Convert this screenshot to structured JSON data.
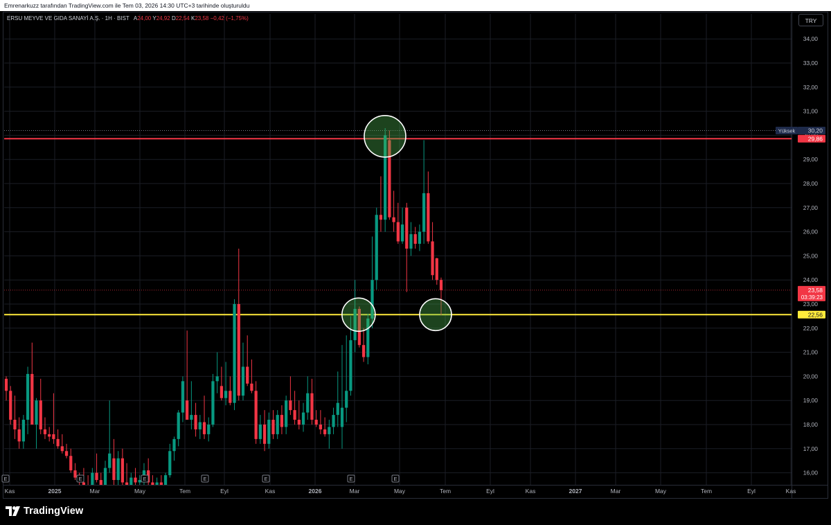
{
  "header": {
    "caption": "Emrenarkuzz tarafından TradingView.com ile Tem 03, 2026 14:30 UTC+3 tarihinde oluşturuldu"
  },
  "legend": {
    "symbol": "ERSU MEYVE VE GIDA SANAYİ A.Ş. · 1H · BIST",
    "open_label": "A",
    "open": "24,00",
    "high_label": "Y",
    "high": "24,92",
    "low_label": "D",
    "low": "22,54",
    "close_label": "K",
    "close": "23,58",
    "change": "−0,42 (−1,75%)"
  },
  "currency_button": "TRY",
  "brand": "TradingView",
  "chart_data": {
    "type": "candlestick",
    "title": "",
    "y_axis": {
      "min": 15.7,
      "max": 34.6,
      "ticks": [
        16,
        17,
        18,
        19,
        20,
        21,
        22,
        23,
        24,
        25,
        26,
        27,
        28,
        29,
        30,
        31,
        32,
        33,
        34
      ],
      "tick_labels": [
        "16,00",
        "17,00",
        "18,00",
        "19,00",
        "20,00",
        "21,00",
        "22,00",
        "23,00",
        "24,00",
        "25,00",
        "26,00",
        "27,00",
        "28,00",
        "29,00",
        "30,00",
        "31,00",
        "32,00",
        "33,00",
        "34,00"
      ],
      "position": "right"
    },
    "x_axis": {
      "labels": [
        "Kas",
        "2025",
        "Mar",
        "May",
        "Tem",
        "Eyl",
        "Kas",
        "2026",
        "Mar",
        "May",
        "Tem",
        "Eyl",
        "Kas",
        "2027",
        "Mar",
        "May",
        "Tem",
        "Eyl",
        "Kas"
      ],
      "bold_labels": [
        "2025",
        "2026",
        "2027"
      ]
    },
    "earnings_markers": {
      "label": "E",
      "count": 7
    },
    "horizontal_lines": [
      {
        "value": 29.86,
        "label": "29,86",
        "color": "#f23645"
      },
      {
        "value": 22.56,
        "label": "22,56",
        "color": "#ffeb3b"
      }
    ],
    "high_marker": {
      "value": 30.2,
      "label": "30,20",
      "title": "Yüksek"
    },
    "last_price": {
      "value": 23.58,
      "label": "23,58",
      "countdown": "03:39:23"
    },
    "highlight_circles": 3,
    "colors": {
      "up": "#089981",
      "down": "#f23645",
      "grid": "#1b1e26",
      "axis_text": "#b2b5be"
    },
    "candles": [
      {
        "o": 19.9,
        "h": 20.0,
        "l": 19.0,
        "c": 19.4
      },
      {
        "o": 19.4,
        "h": 19.6,
        "l": 18.0,
        "c": 18.2
      },
      {
        "o": 18.2,
        "h": 19.2,
        "l": 17.4,
        "c": 17.8
      },
      {
        "o": 17.8,
        "h": 18.3,
        "l": 17.0,
        "c": 17.3
      },
      {
        "o": 17.3,
        "h": 18.4,
        "l": 17.0,
        "c": 18.2
      },
      {
        "o": 18.2,
        "h": 20.4,
        "l": 17.6,
        "c": 20.1
      },
      {
        "o": 20.1,
        "h": 21.4,
        "l": 18.0,
        "c": 18.0
      },
      {
        "o": 18.0,
        "h": 19.1,
        "l": 17.0,
        "c": 19.0
      },
      {
        "o": 19.0,
        "h": 19.9,
        "l": 17.6,
        "c": 17.8
      },
      {
        "o": 17.8,
        "h": 18.3,
        "l": 17.4,
        "c": 17.6
      },
      {
        "o": 17.6,
        "h": 17.9,
        "l": 17.3,
        "c": 17.5
      },
      {
        "o": 17.6,
        "h": 19.3,
        "l": 17.2,
        "c": 17.4
      },
      {
        "o": 17.4,
        "h": 17.8,
        "l": 17.0,
        "c": 17.1
      },
      {
        "o": 17.1,
        "h": 17.6,
        "l": 16.8,
        "c": 16.9
      },
      {
        "o": 16.9,
        "h": 17.2,
        "l": 16.6,
        "c": 16.7
      },
      {
        "o": 16.7,
        "h": 17.0,
        "l": 16.0,
        "c": 16.1
      },
      {
        "o": 16.1,
        "h": 16.4,
        "l": 15.7,
        "c": 15.8
      },
      {
        "o": 15.8,
        "h": 16.0,
        "l": 15.5,
        "c": 15.6
      },
      {
        "o": 15.6,
        "h": 16.2,
        "l": 15.3,
        "c": 15.5
      },
      {
        "o": 15.5,
        "h": 15.9,
        "l": 15.2,
        "c": 15.4
      },
      {
        "o": 15.4,
        "h": 16.2,
        "l": 15.3,
        "c": 16.0
      },
      {
        "o": 16.0,
        "h": 16.8,
        "l": 15.6,
        "c": 15.7
      },
      {
        "o": 15.7,
        "h": 16.0,
        "l": 15.3,
        "c": 15.5
      },
      {
        "o": 15.5,
        "h": 16.5,
        "l": 15.4,
        "c": 16.2
      },
      {
        "o": 16.2,
        "h": 19.0,
        "l": 16.0,
        "c": 16.8
      },
      {
        "o": 16.6,
        "h": 17.4,
        "l": 15.4,
        "c": 15.7
      },
      {
        "o": 15.7,
        "h": 16.9,
        "l": 15.4,
        "c": 16.6
      },
      {
        "o": 16.6,
        "h": 17.0,
        "l": 15.4,
        "c": 15.6
      },
      {
        "o": 15.6,
        "h": 16.4,
        "l": 15.2,
        "c": 15.5
      },
      {
        "o": 15.5,
        "h": 16.0,
        "l": 15.2,
        "c": 15.8
      },
      {
        "o": 15.8,
        "h": 16.2,
        "l": 15.4,
        "c": 15.6
      },
      {
        "o": 15.6,
        "h": 15.9,
        "l": 15.3,
        "c": 15.7
      },
      {
        "o": 15.7,
        "h": 16.4,
        "l": 15.4,
        "c": 16.1
      },
      {
        "o": 16.1,
        "h": 16.6,
        "l": 15.5,
        "c": 15.6
      },
      {
        "o": 15.6,
        "h": 15.9,
        "l": 15.2,
        "c": 15.5
      },
      {
        "o": 15.5,
        "h": 15.8,
        "l": 15.3,
        "c": 15.6
      },
      {
        "o": 15.6,
        "h": 15.9,
        "l": 15.3,
        "c": 15.4
      },
      {
        "o": 15.4,
        "h": 16.0,
        "l": 15.3,
        "c": 15.9
      },
      {
        "o": 15.9,
        "h": 17.2,
        "l": 15.8,
        "c": 16.9
      },
      {
        "o": 16.9,
        "h": 17.5,
        "l": 16.5,
        "c": 17.4
      },
      {
        "o": 17.4,
        "h": 18.6,
        "l": 17.1,
        "c": 18.5
      },
      {
        "o": 18.5,
        "h": 20.0,
        "l": 18.1,
        "c": 19.8
      },
      {
        "o": 19.0,
        "h": 21.9,
        "l": 18.2,
        "c": 18.2
      },
      {
        "o": 18.2,
        "h": 19.8,
        "l": 17.8,
        "c": 18.4
      },
      {
        "o": 18.4,
        "h": 18.9,
        "l": 17.5,
        "c": 17.8
      },
      {
        "o": 17.8,
        "h": 18.4,
        "l": 17.4,
        "c": 18.1
      },
      {
        "o": 18.1,
        "h": 19.2,
        "l": 17.4,
        "c": 17.6
      },
      {
        "o": 17.6,
        "h": 18.3,
        "l": 17.3,
        "c": 18.0
      },
      {
        "o": 18.0,
        "h": 20.1,
        "l": 17.9,
        "c": 19.8
      },
      {
        "o": 19.8,
        "h": 21.0,
        "l": 19.3,
        "c": 20.0
      },
      {
        "o": 19.6,
        "h": 20.4,
        "l": 19.0,
        "c": 19.1
      },
      {
        "o": 19.1,
        "h": 20.6,
        "l": 18.8,
        "c": 19.4
      },
      {
        "o": 19.4,
        "h": 20.0,
        "l": 18.8,
        "c": 18.9
      },
      {
        "o": 18.9,
        "h": 23.2,
        "l": 18.6,
        "c": 23.0
      },
      {
        "o": 23.0,
        "h": 25.3,
        "l": 19.0,
        "c": 19.2
      },
      {
        "o": 19.2,
        "h": 21.4,
        "l": 19.0,
        "c": 20.4
      },
      {
        "o": 20.4,
        "h": 21.7,
        "l": 19.6,
        "c": 19.7
      },
      {
        "o": 19.7,
        "h": 20.7,
        "l": 19.3,
        "c": 19.4
      },
      {
        "o": 19.4,
        "h": 19.8,
        "l": 17.2,
        "c": 17.4
      },
      {
        "o": 17.4,
        "h": 18.4,
        "l": 17.2,
        "c": 18.0
      },
      {
        "o": 18.0,
        "h": 18.6,
        "l": 16.9,
        "c": 17.2
      },
      {
        "o": 17.2,
        "h": 18.5,
        "l": 17.0,
        "c": 18.2
      },
      {
        "o": 18.2,
        "h": 18.6,
        "l": 17.4,
        "c": 17.6
      },
      {
        "o": 17.6,
        "h": 18.6,
        "l": 17.4,
        "c": 18.4
      },
      {
        "o": 18.4,
        "h": 18.8,
        "l": 17.6,
        "c": 17.9
      },
      {
        "o": 17.9,
        "h": 19.2,
        "l": 17.6,
        "c": 19.0
      },
      {
        "o": 19.0,
        "h": 20.0,
        "l": 18.4,
        "c": 18.6
      },
      {
        "o": 18.6,
        "h": 19.4,
        "l": 18.0,
        "c": 18.2
      },
      {
        "o": 18.2,
        "h": 19.0,
        "l": 17.8,
        "c": 18.0
      },
      {
        "o": 18.0,
        "h": 18.9,
        "l": 17.7,
        "c": 18.5
      },
      {
        "o": 18.5,
        "h": 20.0,
        "l": 18.2,
        "c": 19.3
      },
      {
        "o": 19.3,
        "h": 19.9,
        "l": 18.0,
        "c": 18.2
      },
      {
        "o": 18.2,
        "h": 18.6,
        "l": 17.9,
        "c": 18.0
      },
      {
        "o": 18.0,
        "h": 18.6,
        "l": 17.6,
        "c": 17.8
      },
      {
        "o": 17.8,
        "h": 18.3,
        "l": 17.5,
        "c": 17.6
      },
      {
        "o": 17.6,
        "h": 18.2,
        "l": 17.0,
        "c": 17.9
      },
      {
        "o": 17.9,
        "h": 18.7,
        "l": 17.6,
        "c": 18.4
      },
      {
        "o": 18.4,
        "h": 20.2,
        "l": 17.9,
        "c": 18.9
      },
      {
        "o": 17.9,
        "h": 21.3,
        "l": 17.0,
        "c": 18.7
      },
      {
        "o": 18.7,
        "h": 21.7,
        "l": 18.1,
        "c": 19.4
      },
      {
        "o": 19.4,
        "h": 22.5,
        "l": 19.2,
        "c": 21.5
      },
      {
        "o": 21.5,
        "h": 24.0,
        "l": 21.0,
        "c": 22.8
      },
      {
        "o": 22.8,
        "h": 22.9,
        "l": 21.2,
        "c": 21.3
      },
      {
        "o": 21.3,
        "h": 22.0,
        "l": 20.6,
        "c": 20.8
      },
      {
        "o": 20.8,
        "h": 22.6,
        "l": 20.5,
        "c": 22.4
      },
      {
        "o": 22.4,
        "h": 25.8,
        "l": 22.0,
        "c": 24.0
      },
      {
        "o": 24.0,
        "h": 27.0,
        "l": 23.6,
        "c": 26.7
      },
      {
        "o": 26.7,
        "h": 28.3,
        "l": 26.0,
        "c": 26.5
      },
      {
        "o": 26.5,
        "h": 30.3,
        "l": 26.0,
        "c": 30.0
      },
      {
        "o": 29.8,
        "h": 30.2,
        "l": 26.5,
        "c": 26.6
      },
      {
        "o": 26.6,
        "h": 27.7,
        "l": 26.0,
        "c": 26.4
      },
      {
        "o": 26.4,
        "h": 27.2,
        "l": 25.5,
        "c": 25.6
      },
      {
        "o": 25.6,
        "h": 27.0,
        "l": 25.5,
        "c": 26.3
      },
      {
        "o": 27.0,
        "h": 27.2,
        "l": 23.5,
        "c": 25.3
      },
      {
        "o": 25.3,
        "h": 26.4,
        "l": 25.0,
        "c": 25.9
      },
      {
        "o": 25.9,
        "h": 26.2,
        "l": 25.3,
        "c": 25.5
      },
      {
        "o": 25.5,
        "h": 26.3,
        "l": 25.2,
        "c": 26.0
      },
      {
        "o": 26.0,
        "h": 29.8,
        "l": 25.5,
        "c": 27.6
      },
      {
        "o": 27.6,
        "h": 28.5,
        "l": 25.5,
        "c": 25.6
      },
      {
        "o": 25.6,
        "h": 26.4,
        "l": 24.0,
        "c": 24.2
      },
      {
        "o": 24.9,
        "h": 24.92,
        "l": 23.8,
        "c": 24.0
      },
      {
        "o": 24.0,
        "h": 24.1,
        "l": 22.54,
        "c": 23.58
      }
    ]
  }
}
